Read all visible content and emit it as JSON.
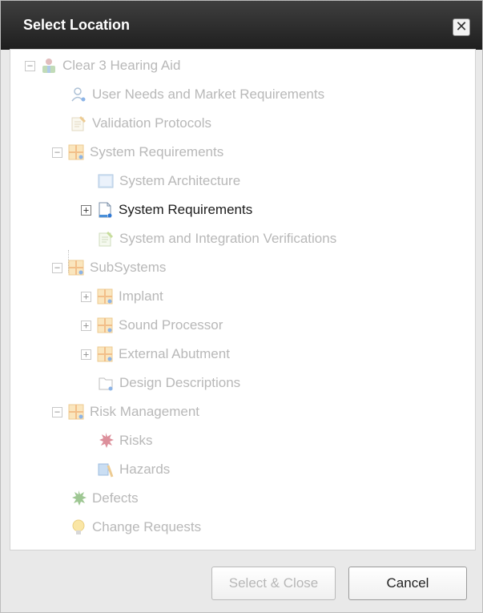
{
  "window": {
    "title": "Select Location",
    "close_glyph": "✕"
  },
  "tree": {
    "items": [
      {
        "label": "Clear 3 Hearing Aid",
        "toggle": "−",
        "icon": "product-icon"
      },
      {
        "label": "User Needs and Market Requirements",
        "icon": "user-needs-icon"
      },
      {
        "label": "Validation Protocols",
        "icon": "validation-icon"
      },
      {
        "label": "System Requirements",
        "toggle": "−",
        "icon": "folder-grid-icon"
      },
      {
        "label": "System Architecture",
        "icon": "architecture-icon"
      },
      {
        "label": "System Requirements",
        "toggle": "+",
        "icon": "document-icon",
        "active": true
      },
      {
        "label": "System and Integration Verifications",
        "icon": "verification-icon"
      },
      {
        "label": "SubSystems",
        "toggle": "−",
        "icon": "folder-grid-icon"
      },
      {
        "label": "Implant",
        "toggle": "+",
        "icon": "folder-grid-icon"
      },
      {
        "label": "Sound Processor",
        "toggle": "+",
        "icon": "folder-grid-icon"
      },
      {
        "label": "External Abutment",
        "toggle": "+",
        "icon": "folder-grid-icon"
      },
      {
        "label": "Design Descriptions",
        "icon": "design-icon"
      },
      {
        "label": "Risk Management",
        "toggle": "−",
        "icon": "folder-grid-icon"
      },
      {
        "label": "Risks",
        "icon": "risk-icon"
      },
      {
        "label": "Hazards",
        "icon": "hazard-icon"
      },
      {
        "label": "Defects",
        "icon": "defect-icon"
      },
      {
        "label": "Change Requests",
        "icon": "lightbulb-icon"
      }
    ]
  },
  "buttons": {
    "select_close": "Select & Close",
    "cancel": "Cancel"
  },
  "colors": {
    "titlebar": "#2a2a2a",
    "disabled_text": "#b8b8b8",
    "active_text": "#1b1b1b",
    "folder_orange": "#f2a93b",
    "accent_blue": "#2f78d4"
  }
}
